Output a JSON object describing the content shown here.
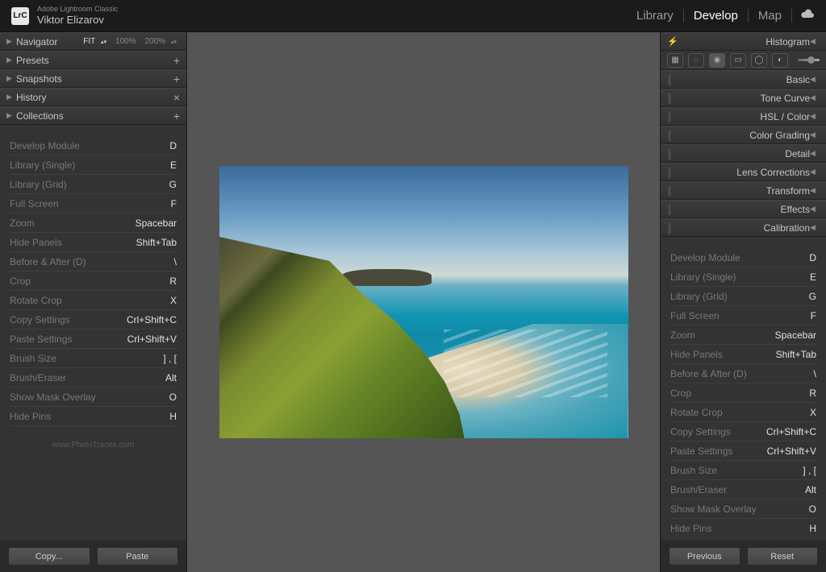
{
  "app": {
    "name": "Adobe Lightroom Classic",
    "user": "Viktor Elizarov",
    "logo": "LrC"
  },
  "modules": [
    {
      "label": "Library",
      "active": false
    },
    {
      "label": "Develop",
      "active": true
    },
    {
      "label": "Map",
      "active": false
    }
  ],
  "left_panels": {
    "navigator": {
      "label": "Navigator",
      "zoom_fit": "FIT",
      "zoom_100": "100%",
      "zoom_200": "200%"
    },
    "items": [
      {
        "label": "Presets",
        "action": "+"
      },
      {
        "label": "Snapshots",
        "action": "+"
      },
      {
        "label": "History",
        "action": "×"
      },
      {
        "label": "Collections",
        "action": "+"
      }
    ]
  },
  "shortcuts": [
    {
      "label": "Develop Module",
      "key": "D"
    },
    {
      "label": "Library (Single)",
      "key": "E"
    },
    {
      "label": "Library (Grid)",
      "key": "G"
    },
    {
      "label": "Full Screen",
      "key": "F"
    },
    {
      "label": "Zoom",
      "key": "Spacebar"
    },
    {
      "label": "Hide Panels",
      "key": "Shift+Tab"
    },
    {
      "label": "Before & After (D)",
      "key": "\\"
    },
    {
      "label": "Crop",
      "key": "R"
    },
    {
      "label": "Rotate Crop",
      "key": "X"
    },
    {
      "label": "Copy Settings",
      "key": "Crl+Shift+C"
    },
    {
      "label": "Paste Settings",
      "key": "Crl+Shift+V"
    },
    {
      "label": "Brush Size",
      "key": "] , ["
    },
    {
      "label": "Brush/Eraser",
      "key": "Alt"
    },
    {
      "label": "Show Mask Overlay",
      "key": "O"
    },
    {
      "label": "Hide Pins",
      "key": "H"
    }
  ],
  "credit": "www.PhotoTraces.com",
  "left_buttons": {
    "copy": "Copy...",
    "paste": "Paste"
  },
  "right_panels": {
    "histogram": "Histogram",
    "items": [
      {
        "label": "Basic"
      },
      {
        "label": "Tone Curve"
      },
      {
        "label": "HSL / Color"
      },
      {
        "label": "Color Grading"
      },
      {
        "label": "Detail"
      },
      {
        "label": "Lens Corrections"
      },
      {
        "label": "Transform"
      },
      {
        "label": "Effects"
      },
      {
        "label": "Calibration"
      }
    ]
  },
  "right_buttons": {
    "previous": "Previous",
    "reset": "Reset"
  }
}
